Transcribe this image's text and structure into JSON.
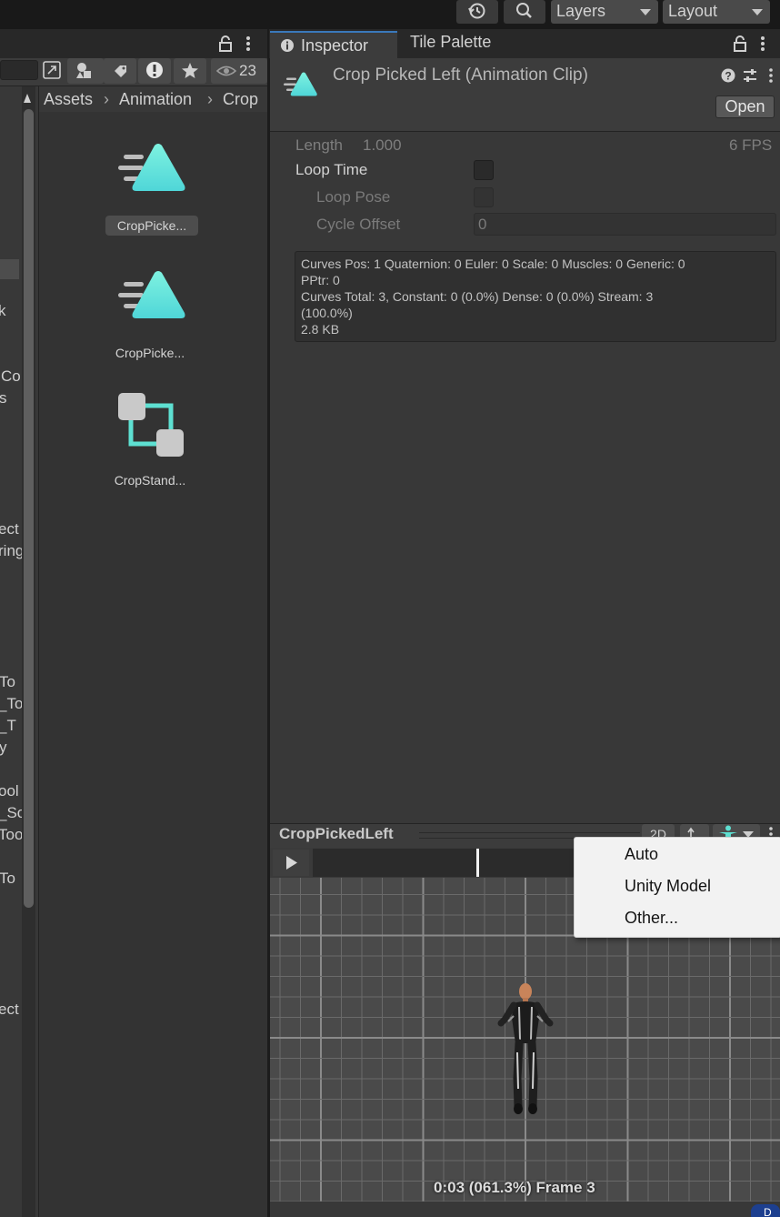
{
  "toolbar": {
    "layers_label": "Layers",
    "layout_label": "Layout",
    "history_icon": "history-icon",
    "search_icon": "search-icon"
  },
  "project": {
    "eye_count": "23",
    "breadcrumb": [
      "Assets",
      "Animation",
      "Crop"
    ],
    "assets": [
      {
        "label": "CropPicke...",
        "icon": "animation-clip-icon",
        "selected": true
      },
      {
        "label": "CropPicke...",
        "icon": "animation-clip-icon",
        "selected": false
      },
      {
        "label": "CropStand...",
        "icon": "animator-controller-icon",
        "selected": false
      }
    ],
    "tree_fragments": [
      "k",
      "Co",
      "s",
      "ect",
      "ring",
      "To",
      "_To",
      "_T",
      "y",
      "ool",
      "_So",
      "Too",
      "To",
      "ect"
    ]
  },
  "inspector": {
    "tab_inspector": "Inspector",
    "tab_tile_palette": "Tile Palette",
    "title": "Crop Picked Left (Animation Clip)",
    "open_button": "Open",
    "length_label": "Length",
    "length_value": "1.000",
    "fps": "6 FPS",
    "loop_time_label": "Loop Time",
    "loop_pose_label": "Loop Pose",
    "cycle_offset_label": "Cycle Offset",
    "cycle_offset_value": "0",
    "curves_lines": [
      "Curves Pos: 1 Quaternion: 0 Euler: 0 Scale: 0 Muscles: 0 Generic: 0",
      "PPtr: 0",
      "Curves Total: 3, Constant: 0 (0.0%) Dense: 0 (0.0%) Stream: 3",
      "(100.0%)",
      "2.8 KB"
    ]
  },
  "preview": {
    "title": "CropPickedLeft",
    "mode_2d": "2D",
    "status": "0:03 (061.3%) Frame 3",
    "playhead_fraction": 0.613
  },
  "menu": {
    "items": [
      "Auto",
      "Unity Model",
      "Other..."
    ]
  },
  "colors": {
    "clip_accent": "#5ee0d2",
    "tab_accent": "#3a79bb"
  }
}
